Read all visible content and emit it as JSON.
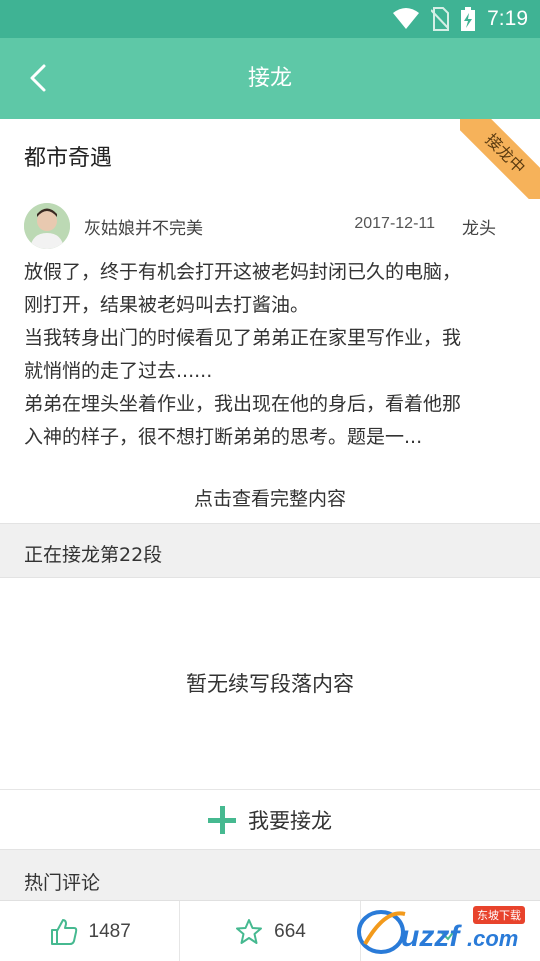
{
  "status_bar": {
    "time": "7:19",
    "icons": [
      "wifi-icon",
      "no-sim-icon",
      "battery-charging-icon"
    ]
  },
  "toolbar": {
    "title": "接龙",
    "back_icon": "chevron-left-icon"
  },
  "ribbon": {
    "label": "接龙中",
    "color": "#f6b25a"
  },
  "story": {
    "title": "都市奇遇",
    "author": "灰姑娘并不完美",
    "date": "2017-12-11",
    "role": "龙头",
    "lines": [
      "放假了，终于有机会打开这被老妈封闭已久的电脑，",
      "刚打开，结果被老妈叫去打酱油。",
      "当我转身出门的时候看见了弟弟正在家里写作业，我",
      "就悄悄的走了过去......",
      "弟弟在埋头坐着作业，我出现在他的身后，看着他那",
      "入神的样子，很不想打断弟弟的思考。题是一..."
    ],
    "view_full": "点击查看完整内容"
  },
  "relay": {
    "header": "正在接龙第22段",
    "empty": "暂无续写段落内容",
    "continue_label": "我要接龙"
  },
  "comments": {
    "header": "热门评论"
  },
  "bottom_bar": {
    "likes": "1487",
    "favorites": "664"
  },
  "watermark": {
    "text": "uzzf.com",
    "tag": "东坡下载"
  },
  "colors": {
    "toolbar": "#5ec8a7",
    "status_bar": "#3fb394",
    "accent": "#46b990"
  }
}
